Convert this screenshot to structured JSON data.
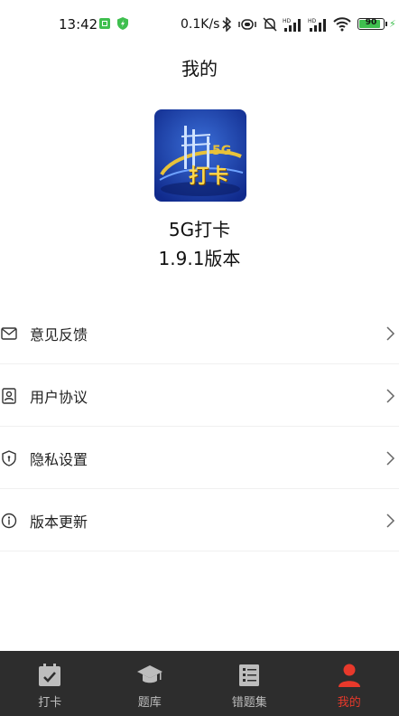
{
  "status_bar": {
    "time": "13:42",
    "speed": "0.1K/s",
    "battery": "90",
    "battery_level": 0.9
  },
  "page_title": "我的",
  "app": {
    "name": "5G打卡",
    "version": "1.9.1版本",
    "logo_text_5g": "5G",
    "logo_text": "打卡"
  },
  "menu": {
    "items": [
      {
        "label": "意见反馈",
        "icon": "mail-icon"
      },
      {
        "label": "用户协议",
        "icon": "user-agreement-icon"
      },
      {
        "label": "隐私设置",
        "icon": "shield-icon"
      },
      {
        "label": "版本更新",
        "icon": "info-icon"
      }
    ]
  },
  "tabbar": {
    "tabs": [
      {
        "label": "打卡",
        "icon": "calendar-check-icon"
      },
      {
        "label": "题库",
        "icon": "graduation-cap-icon"
      },
      {
        "label": "错题集",
        "icon": "notebook-icon"
      },
      {
        "label": "我的",
        "icon": "user-icon",
        "active": true
      }
    ],
    "active_color": "#e8392b",
    "inactive_color": "#bdbdbd",
    "background": "#2d2d2d"
  }
}
